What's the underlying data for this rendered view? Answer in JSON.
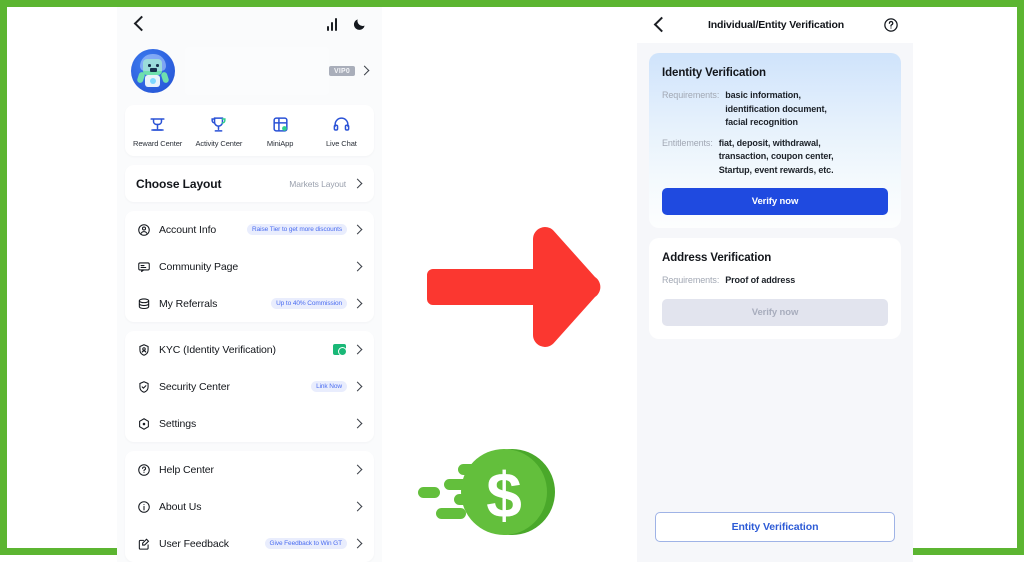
{
  "frame": {
    "border_color": "#5cb531"
  },
  "left_panel": {
    "status_bar": {
      "back_icon": "chevron-left-icon",
      "chart_icon": "bar-chart-icon",
      "theme_icon": "moon-icon"
    },
    "profile": {
      "avatar_alt": "robot-avatar",
      "vip_badge": "VIP0"
    },
    "quick_actions": [
      {
        "label": "Reward Center",
        "icon": "reward-center-icon"
      },
      {
        "label": "Activity Center",
        "icon": "activity-center-icon"
      },
      {
        "label": "MiniApp",
        "icon": "miniapp-icon"
      },
      {
        "label": "Live Chat",
        "icon": "live-chat-icon"
      }
    ],
    "layout_row": {
      "label": "Choose Layout",
      "value": "Markets Layout"
    },
    "group_account": [
      {
        "label": "Account Info",
        "icon": "user-circle-icon",
        "pill": "Raise Tier to get more discounts"
      },
      {
        "label": "Community Page",
        "icon": "community-icon",
        "pill": ""
      },
      {
        "label": "My Referrals",
        "icon": "referrals-icon",
        "pill": "Up to 40% Commission"
      }
    ],
    "group_security": [
      {
        "label": "KYC (Identity Verification)",
        "icon": "kyc-shield-icon",
        "pill": "",
        "has_kyc_badge": true
      },
      {
        "label": "Security Center",
        "icon": "shield-check-icon",
        "pill": "Link Now",
        "has_kyc_badge": false
      },
      {
        "label": "Settings",
        "icon": "settings-icon",
        "pill": "",
        "has_kyc_badge": false
      }
    ],
    "group_support": [
      {
        "label": "Help Center",
        "icon": "question-circle-icon",
        "pill": ""
      },
      {
        "label": "About Us",
        "icon": "info-circle-icon",
        "pill": ""
      },
      {
        "label": "User Feedback",
        "icon": "feedback-icon",
        "pill": "Give Feedback to Win GT"
      }
    ]
  },
  "center": {
    "arrow_icon": "right-arrow-icon",
    "arrow_color": "#fb3730",
    "logo_icon": "fast-money-dollar-icon",
    "logo_color": "#5cb531"
  },
  "right_panel": {
    "header": {
      "back_icon": "chevron-left-icon",
      "title": "Individual/Entity Verification",
      "help_icon": "help-circle-icon"
    },
    "identity_card": {
      "title": "Identity Verification",
      "requirements_key": "Requirements:",
      "requirements_lines": [
        "basic information,",
        "identification document,",
        "facial recognition"
      ],
      "entitlements_key": "Entitlements:",
      "entitlements_lines": [
        "fiat, deposit, withdrawal,",
        "transaction, coupon center,",
        "Startup, event rewards, etc."
      ],
      "button_label": "Verify now",
      "button_color": "#1f4ae0"
    },
    "address_card": {
      "title": "Address Verification",
      "requirements_key": "Requirements:",
      "requirements_value": "Proof of address",
      "button_label": "Verify now",
      "button_disabled": true
    },
    "entity_button": {
      "label": "Entity Verification",
      "color": "#2d5bd6"
    }
  }
}
